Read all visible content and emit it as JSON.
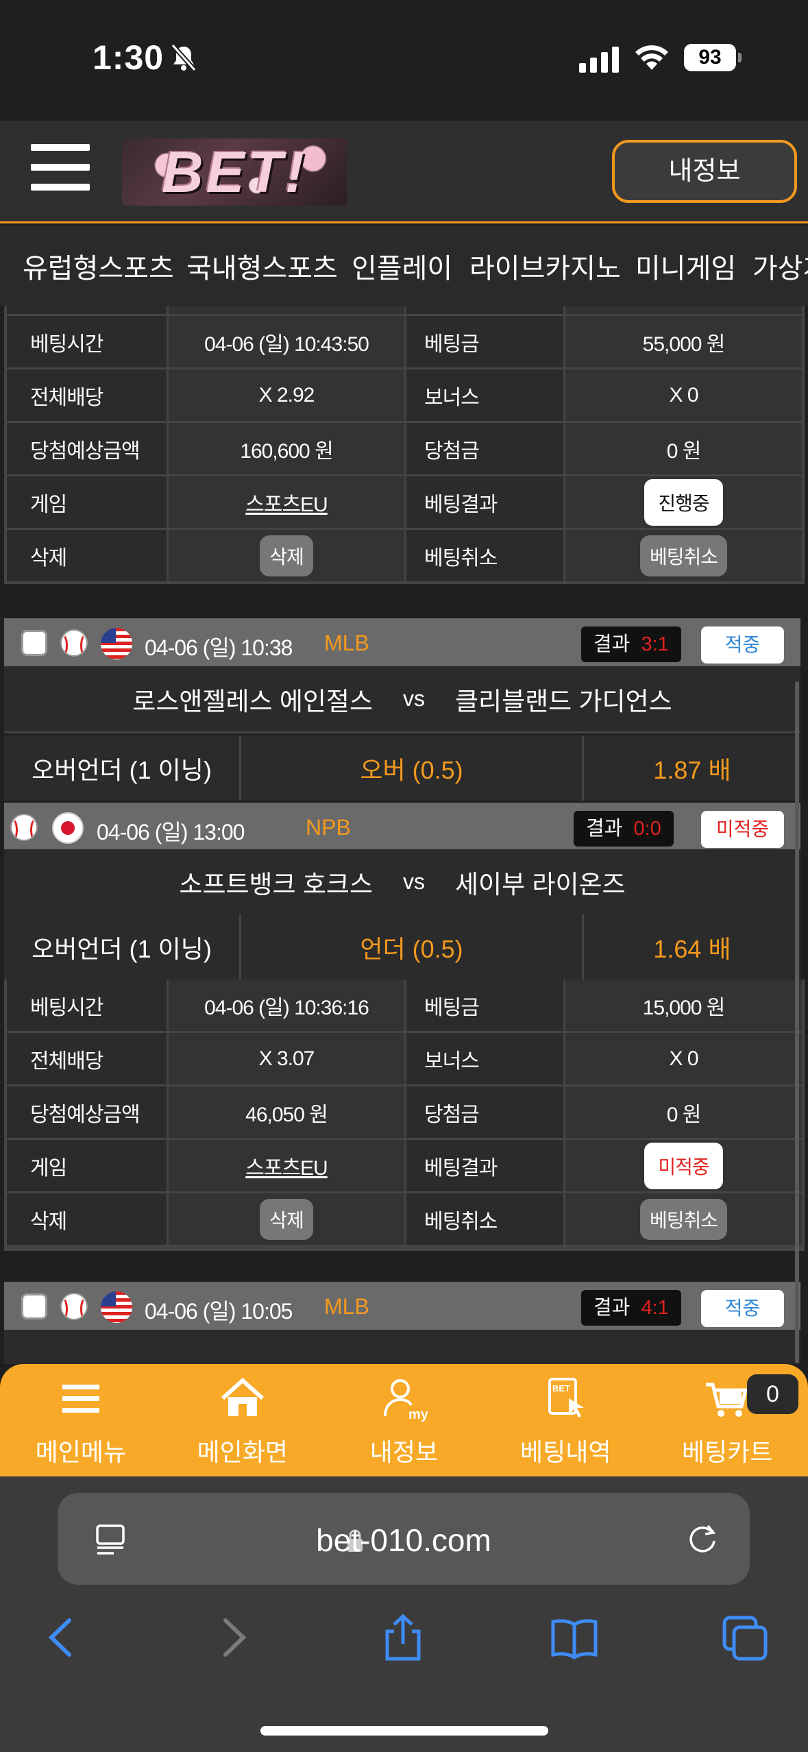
{
  "status_bar": {
    "time": "1:30",
    "battery": "93"
  },
  "header": {
    "logo_text": "BET!",
    "myinfo_label": "내정보"
  },
  "tabs": [
    "유럽형스포츠",
    "국내형스포츠",
    "인플레이",
    "라이브카지노",
    "미니게임",
    "가상게임"
  ],
  "bet1": {
    "rows": [
      {
        "l1": "베팅시간",
        "v1": "04-06 (일) 10:43:50",
        "l2": "베팅금",
        "v2": "55,000 원"
      },
      {
        "l1": "전체배당",
        "v1": "X 2.92",
        "l2": "보너스",
        "v2": "X 0"
      },
      {
        "l1": "당첨예상금액",
        "v1": "160,600 원",
        "l2": "당첨금",
        "v2": "0 원"
      },
      {
        "l1": "게임",
        "v1": "스포츠EU",
        "l2": "베팅결과",
        "v2": "진행중"
      },
      {
        "l1": "삭제",
        "v1": "삭제",
        "l2": "베팅취소",
        "v2": "베팅취소"
      }
    ]
  },
  "bet2": {
    "games": [
      {
        "date": "04-06 (일) 10:38",
        "league": "MLB",
        "result_label": "결과",
        "score": "3:1",
        "status": "적중",
        "home": "로스앤젤레스 에인절스",
        "vs": "vs",
        "away": "클리블랜드 가디언스",
        "market": "오버언더 (1 이닝)",
        "pick": "오버 (0.5)",
        "odds": "1.87 배"
      },
      {
        "date": "04-06 (일) 13:00",
        "league": "NPB",
        "result_label": "결과",
        "score": "0:0",
        "status": "미적중",
        "home": "소프트뱅크 호크스",
        "vs": "vs",
        "away": "세이부 라이온즈",
        "market": "오버언더 (1 이닝)",
        "pick": "언더 (0.5)",
        "odds": "1.64 배"
      }
    ],
    "rows": [
      {
        "l1": "베팅시간",
        "v1": "04-06 (일) 10:36:16",
        "l2": "베팅금",
        "v2": "15,000 원"
      },
      {
        "l1": "전체배당",
        "v1": "X 3.07",
        "l2": "보너스",
        "v2": "X 0"
      },
      {
        "l1": "당첨예상금액",
        "v1": "46,050 원",
        "l2": "당첨금",
        "v2": "0 원"
      },
      {
        "l1": "게임",
        "v1": "스포츠EU",
        "l2": "베팅결과",
        "v2": "미적중"
      },
      {
        "l1": "삭제",
        "v1": "삭제",
        "l2": "베팅취소",
        "v2": "베팅취소"
      }
    ]
  },
  "bet3": {
    "date": "04-06 (일) 10:05",
    "league": "MLB",
    "result_label": "결과",
    "score": "4:1",
    "status": "적중"
  },
  "bottom_nav": {
    "items": [
      "메인메뉴",
      "메인화면",
      "내정보",
      "베팅내역",
      "베팅카트"
    ],
    "cart_count": "0"
  },
  "safari": {
    "url": "bet-010.com"
  },
  "colors": {
    "accent": "#f39a1e",
    "hit": "#2d86d6",
    "miss": "#e0221f",
    "nav_bg": "#f7a927"
  }
}
